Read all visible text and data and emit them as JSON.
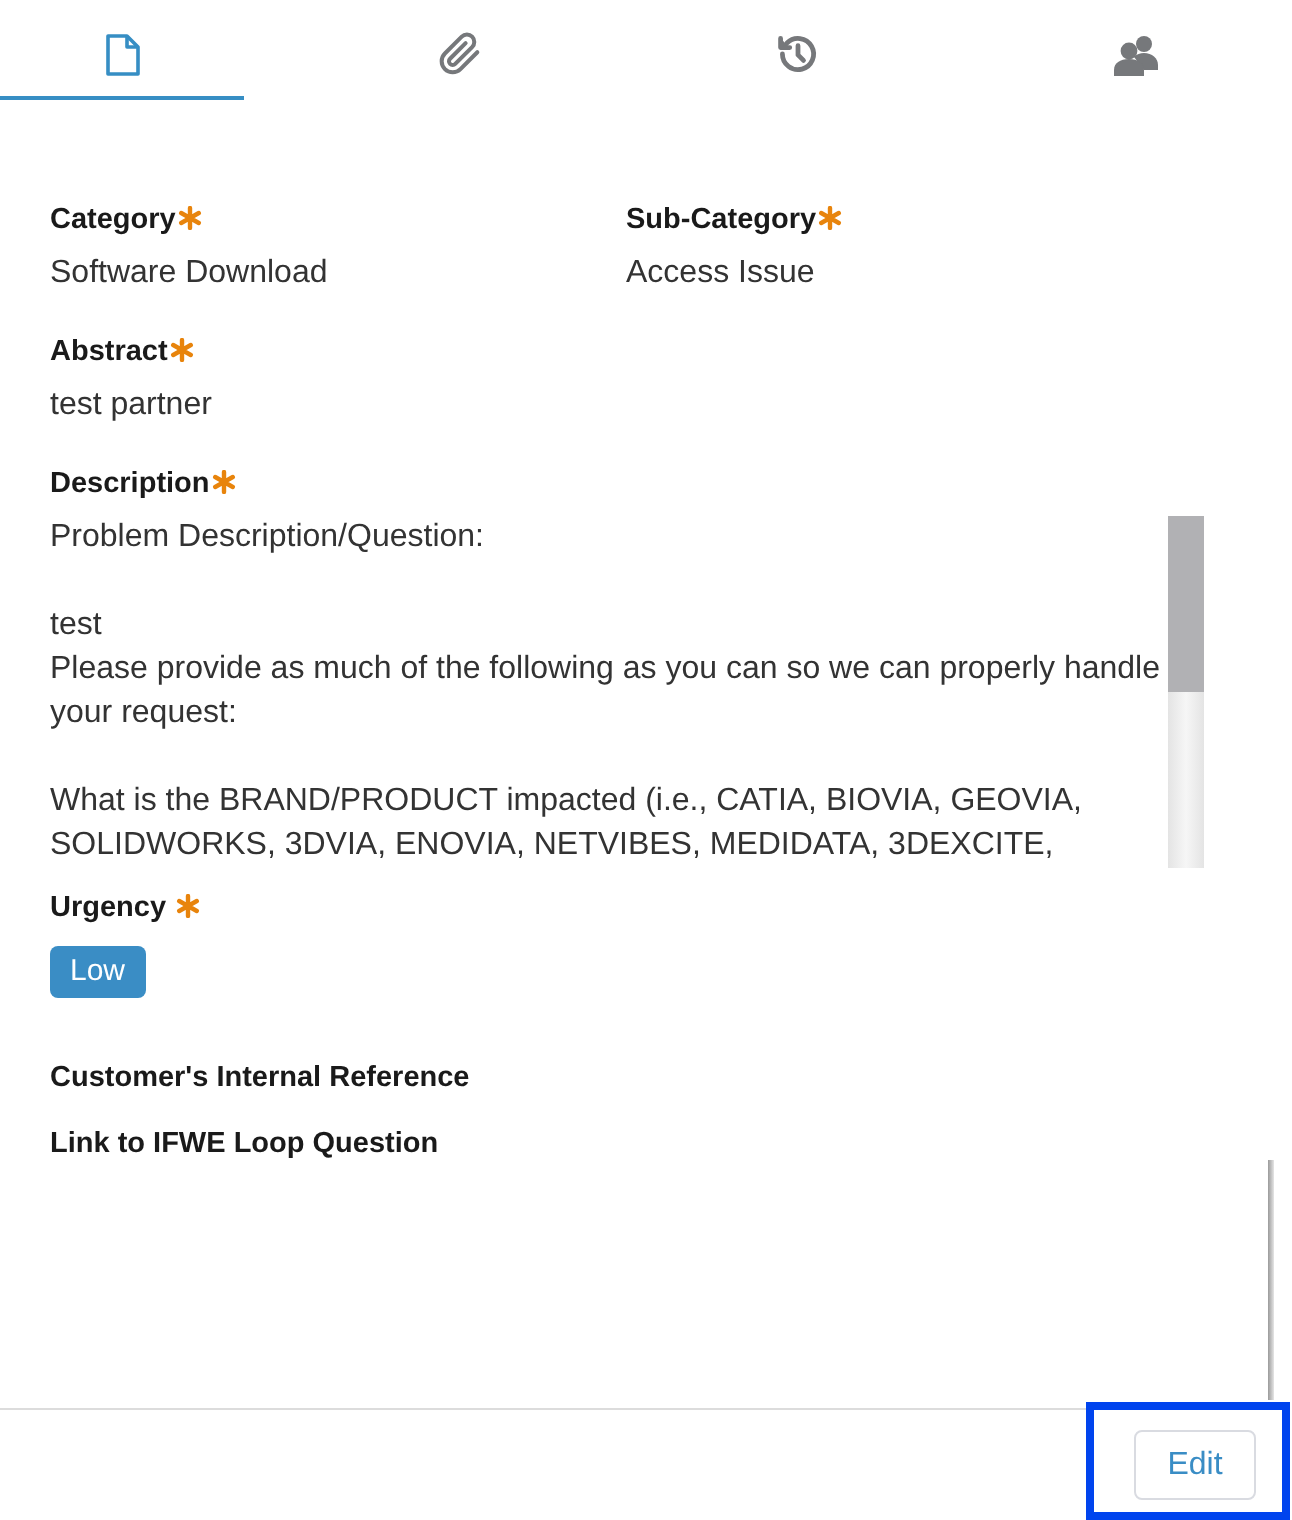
{
  "tabs": [
    {
      "kind": "document",
      "selected": true
    },
    {
      "kind": "paperclip",
      "selected": false
    },
    {
      "kind": "history",
      "selected": false
    },
    {
      "kind": "people",
      "selected": false
    }
  ],
  "form": {
    "rows": [
      {
        "fields": [
          {
            "kind": "text",
            "label": "Category",
            "required": true,
            "value": "Software Download"
          },
          {
            "kind": "text",
            "label": "Sub-Category",
            "required": true,
            "value": "Access Issue"
          }
        ]
      },
      {
        "fields": [
          {
            "kind": "text",
            "label": "Abstract",
            "required": true,
            "value": "test partner"
          }
        ]
      },
      {
        "fields": [
          {
            "kind": "scroll_text",
            "label": "Description",
            "required": true,
            "value": "Problem Description/Question:\n\ntest\nPlease provide as much of the following as you can so we can properly handle your request:\n\nWhat is the BRAND/PRODUCT impacted (i.e., CATIA, BIOVIA, GEOVIA, SOLIDWORKS, 3DVIA, ENOVIA, NETVIBES, MEDIDATA, 3DEXCITE,"
          }
        ]
      },
      {
        "fields": [
          {
            "kind": "tag",
            "label": "Urgency",
            "required": true,
            "value": "Low"
          }
        ]
      },
      {
        "fields": [
          {
            "kind": "empty",
            "label": "Customer's Internal Reference",
            "required": false
          }
        ]
      },
      {
        "fields": [
          {
            "kind": "empty",
            "label": "Link to IFWE Loop Question",
            "required": false
          }
        ]
      }
    ]
  },
  "footer": {
    "buttons": [
      {
        "label": "Edit",
        "highlighted": true
      }
    ]
  }
}
